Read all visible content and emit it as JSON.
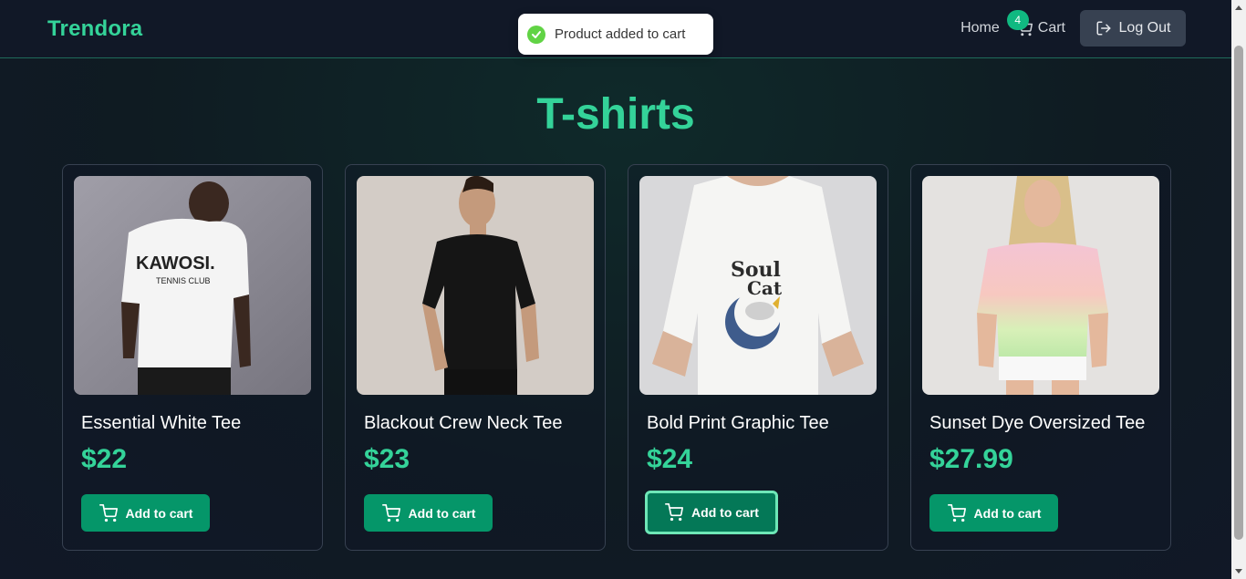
{
  "brand": {
    "name": "Trendora",
    "accent_color": "#34d399"
  },
  "nav": {
    "home_label": "Home",
    "cart_label": "Cart",
    "cart_count": "4",
    "logout_label": "Log Out"
  },
  "toast": {
    "message": "Product added to cart",
    "icon": "check-circle-icon"
  },
  "page": {
    "title": "T-shirts"
  },
  "products": [
    {
      "name": "Essential White Tee",
      "price": "$22",
      "button_label": "Add to cart",
      "image": "white-tee-photo"
    },
    {
      "name": "Blackout Crew Neck Tee",
      "price": "$23",
      "button_label": "Add to cart",
      "image": "black-tee-photo"
    },
    {
      "name": "Bold Print Graphic Tee",
      "price": "$24",
      "button_label": "Add to cart",
      "image": "graphic-tee-photo"
    },
    {
      "name": "Sunset Dye Oversized Tee",
      "price": "$27.99",
      "button_label": "Add to cart",
      "image": "tie-dye-tee-photo"
    }
  ]
}
